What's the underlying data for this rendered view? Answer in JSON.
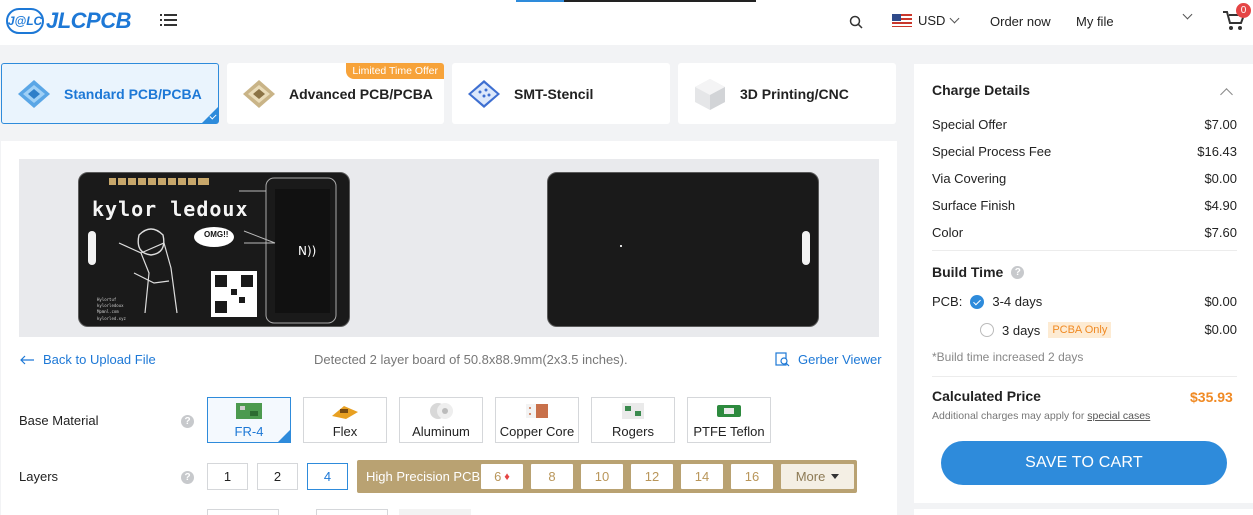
{
  "header": {
    "logo_badge": "J@LC",
    "logo_text": "JLCPCB",
    "currency": "USD",
    "order_now": "Order now",
    "my_file": "My file",
    "cart_count": "0"
  },
  "tabs": [
    {
      "label": "Standard PCB/PCBA",
      "icon": "standard-pcb-icon"
    },
    {
      "label": "Advanced PCB/PCBA",
      "icon": "advanced-pcb-icon",
      "badge": "Limited Time Offer"
    },
    {
      "label": "SMT-Stencil",
      "icon": "smt-stencil-icon"
    },
    {
      "label": "3D Printing/CNC",
      "icon": "3d-printing-icon"
    }
  ],
  "preview": {
    "board_text": "kylor ledoux",
    "bubble_text": "OMG!!"
  },
  "upload": {
    "back": "Back to Upload File",
    "detected": "Detected 2 layer board of 50.8x88.9mm(2x3.5 inches).",
    "gerber": "Gerber Viewer"
  },
  "base_material": {
    "label": "Base Material",
    "help": "?",
    "options": [
      "FR-4",
      "Flex",
      "Aluminum",
      "Copper Core",
      "Rogers",
      "PTFE Teflon"
    ],
    "selected": "FR-4"
  },
  "layers": {
    "label": "Layers",
    "help": "?",
    "options": [
      "1",
      "2",
      "4"
    ],
    "selected": "4",
    "high_precision_label": "High Precision PCB",
    "high_precision_options": [
      "6",
      "8",
      "10",
      "12",
      "14",
      "16"
    ],
    "more": "More"
  },
  "charges": {
    "title": "Charge Details",
    "items": [
      {
        "name": "Special Offer",
        "value": "$7.00"
      },
      {
        "name": "Special Process Fee",
        "value": "$16.43"
      },
      {
        "name": "Via Covering",
        "value": "$0.00"
      },
      {
        "name": "Surface Finish",
        "value": "$4.90"
      },
      {
        "name": "Color",
        "value": "$7.60"
      }
    ]
  },
  "build_time": {
    "title": "Build Time",
    "help": "?",
    "pcb_label": "PCB:",
    "options": [
      {
        "label": "3-4 days",
        "price": "$0.00",
        "selected": true
      },
      {
        "label": "3 days",
        "price": "$0.00",
        "tag": "PCBA Only",
        "selected": false
      }
    ],
    "note": "*Build time increased 2 days"
  },
  "calculated": {
    "title": "Calculated Price",
    "price": "$35.93",
    "note": "Additional charges may apply for",
    "note_link": "special cases",
    "button": "SAVE TO CART"
  },
  "colors": {
    "accent": "#2e8bdb",
    "price": "#f08a24",
    "gold": "#b9a272"
  }
}
